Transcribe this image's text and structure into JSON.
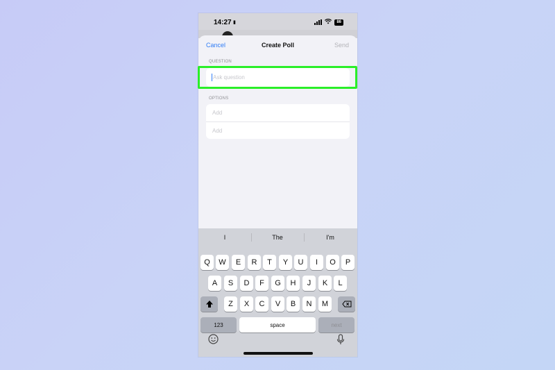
{
  "status": {
    "time": "14:27",
    "battery": "86"
  },
  "nav": {
    "cancel": "Cancel",
    "title": "Create Poll",
    "send": "Send"
  },
  "question": {
    "label": "QUESTION",
    "placeholder": "Ask question"
  },
  "options": {
    "label": "OPTIONS",
    "items": [
      "Add",
      "Add"
    ]
  },
  "predictions": [
    "I",
    "The",
    "I'm"
  ],
  "keyboard": {
    "row1": [
      "Q",
      "W",
      "E",
      "R",
      "T",
      "Y",
      "U",
      "I",
      "O",
      "P"
    ],
    "row2": [
      "A",
      "S",
      "D",
      "F",
      "G",
      "H",
      "J",
      "K",
      "L"
    ],
    "row3": [
      "Z",
      "X",
      "C",
      "V",
      "B",
      "N",
      "M"
    ],
    "numbers": "123",
    "space": "space",
    "next": "next"
  },
  "colors": {
    "accent": "#2f7cf6",
    "highlight": "#2aef28"
  }
}
